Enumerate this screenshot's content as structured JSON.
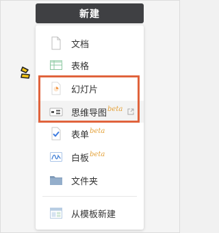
{
  "new_button": {
    "label": "新建"
  },
  "menu": {
    "items": [
      {
        "label": "文档",
        "icon": "document-icon"
      },
      {
        "label": "表格",
        "icon": "sheet-icon"
      },
      {
        "label": "幻灯片",
        "icon": "slides-icon"
      },
      {
        "label": "思维导图",
        "beta": "beta",
        "icon": "mindmap-icon",
        "external_icon": "external-link-icon"
      },
      {
        "label": "表单",
        "beta": "beta",
        "icon": "form-icon"
      },
      {
        "label": "白板",
        "beta": "beta",
        "icon": "whiteboard-icon"
      },
      {
        "label": "文件夹",
        "icon": "folder-icon"
      },
      {
        "label": "从模板新建",
        "icon": "template-icon"
      }
    ]
  },
  "colors": {
    "button_bg": "#3f4043",
    "annotation": "#e0633c",
    "beta": "#e4a23a",
    "sparkle": "#f5c518"
  }
}
